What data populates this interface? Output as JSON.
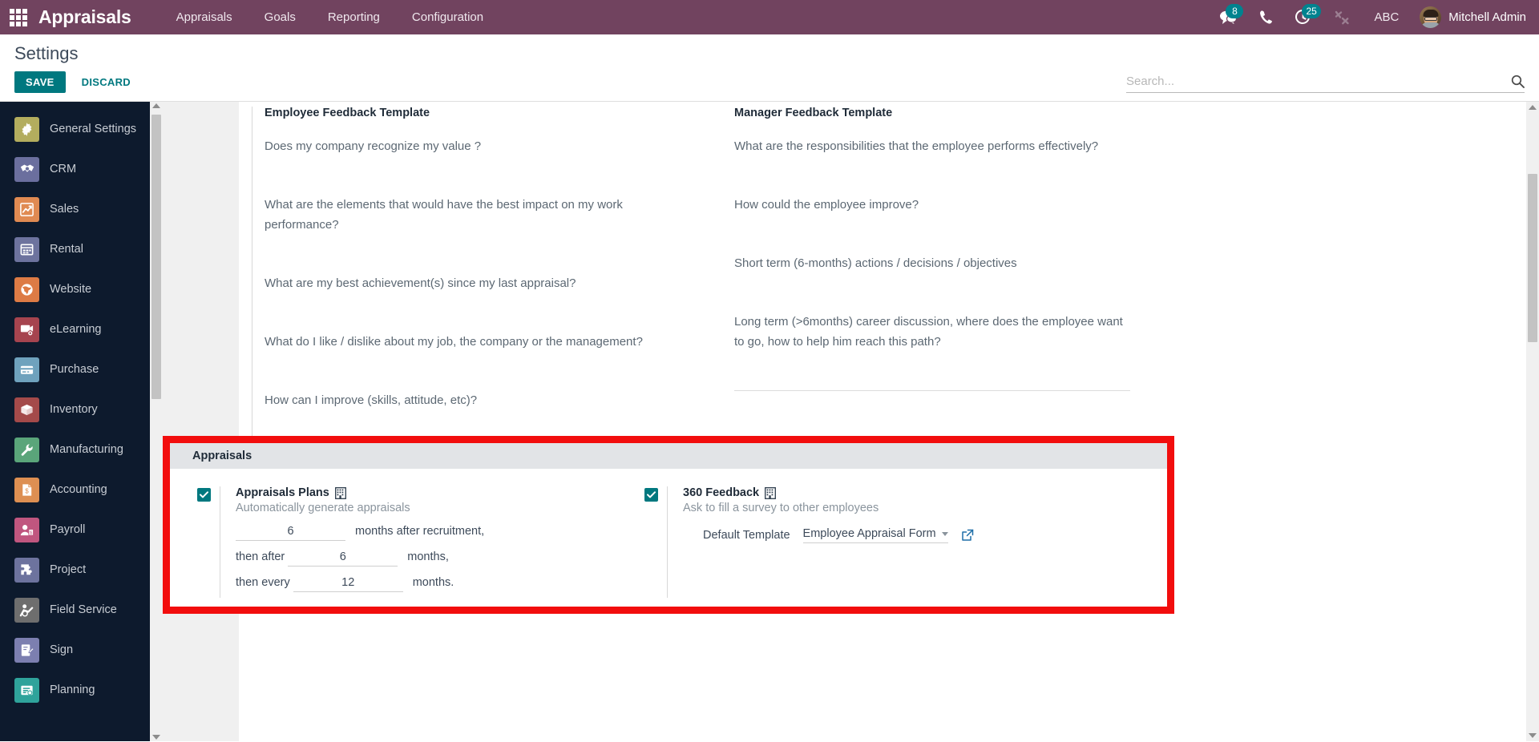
{
  "navbar": {
    "apps_icon": "apps-grid-icon",
    "brand": "Appraisals",
    "menu": [
      {
        "label": "Appraisals"
      },
      {
        "label": "Goals"
      },
      {
        "label": "Reporting"
      },
      {
        "label": "Configuration"
      }
    ],
    "messages": {
      "icon": "messages-icon",
      "badge": "8"
    },
    "phone": {
      "icon": "phone-icon"
    },
    "activities": {
      "icon": "activity-clock-icon",
      "badge": "25"
    },
    "tools": {
      "icon": "wrench-icon"
    },
    "company": "ABC",
    "user": {
      "name": "Mitchell Admin",
      "avatar": "user-avatar"
    }
  },
  "control_panel": {
    "title": "Settings",
    "save_label": "SAVE",
    "discard_label": "DISCARD",
    "search_placeholder": "Search...",
    "search_value": "",
    "search_icon": "search-icon"
  },
  "sidebar": {
    "items": [
      {
        "label": "General Settings",
        "icon": "gear-icon",
        "color": "#b3ad5e"
      },
      {
        "label": "CRM",
        "icon": "handshake-icon",
        "color": "#6b6f9e"
      },
      {
        "label": "Sales",
        "icon": "chart-line-icon",
        "color": "#e08a52"
      },
      {
        "label": "Rental",
        "icon": "calendar-icon",
        "color": "#6d739e"
      },
      {
        "label": "Website",
        "icon": "globe-icon",
        "color": "#dd7b45"
      },
      {
        "label": "eLearning",
        "icon": "elearning-icon",
        "color": "#a6444f"
      },
      {
        "label": "Purchase",
        "icon": "card-icon",
        "color": "#6fa2bd"
      },
      {
        "label": "Inventory",
        "icon": "box-icon",
        "color": "#a44a4a"
      },
      {
        "label": "Manufacturing",
        "icon": "wrench-green-icon",
        "color": "#5aa57a"
      },
      {
        "label": "Accounting",
        "icon": "invoice-icon",
        "color": "#dd8f52"
      },
      {
        "label": "Payroll",
        "icon": "payroll-icon",
        "color": "#c0567f"
      },
      {
        "label": "Project",
        "icon": "puzzle-icon",
        "color": "#6d739e"
      },
      {
        "label": "Field Service",
        "icon": "field-service-icon",
        "color": "#6e6e6e"
      },
      {
        "label": "Sign",
        "icon": "sign-icon",
        "color": "#7c7fb0"
      },
      {
        "label": "Planning",
        "icon": "planning-icon",
        "color": "#2fa39b"
      }
    ]
  },
  "feedback_templates": {
    "employee": {
      "title": "Employee Feedback Template",
      "questions": [
        "Does my company recognize my value ?",
        "What are the elements that would have the best impact on my work performance?",
        "What are my best achievement(s) since my last appraisal?",
        "What do I like / dislike about my job, the company or the management?",
        "How can I improve (skills, attitude, etc)?"
      ]
    },
    "manager": {
      "title": "Manager Feedback Template",
      "questions": [
        "What are the responsibilities that the employee performs effectively?",
        "How could the employee improve?",
        "Short term (6-months) actions / decisions / objectives",
        "Long term (>6months) career discussion, where does the employee want to go, how to help him reach this path?"
      ]
    }
  },
  "appraisals_section": {
    "header": "Appraisals",
    "highlight_color": "#f20d0d",
    "appraisals_plans": {
      "checked": true,
      "title": "Appraisals Plans",
      "company_icon": "building-icon",
      "description": "Automatically generate appraisals",
      "rows": [
        {
          "prefix": "",
          "value": "6",
          "suffix": "months after recruitment,"
        },
        {
          "prefix": "then after",
          "value": "6",
          "suffix": "months,"
        },
        {
          "prefix": "then every",
          "value": "12",
          "suffix": "months."
        }
      ]
    },
    "feedback_360": {
      "checked": true,
      "title": "360 Feedback",
      "company_icon": "building-icon",
      "description": "Ask to fill a survey to other employees",
      "template_label": "Default Template",
      "template_value": "Employee Appraisal Form",
      "external_link_icon": "external-link-icon"
    }
  }
}
